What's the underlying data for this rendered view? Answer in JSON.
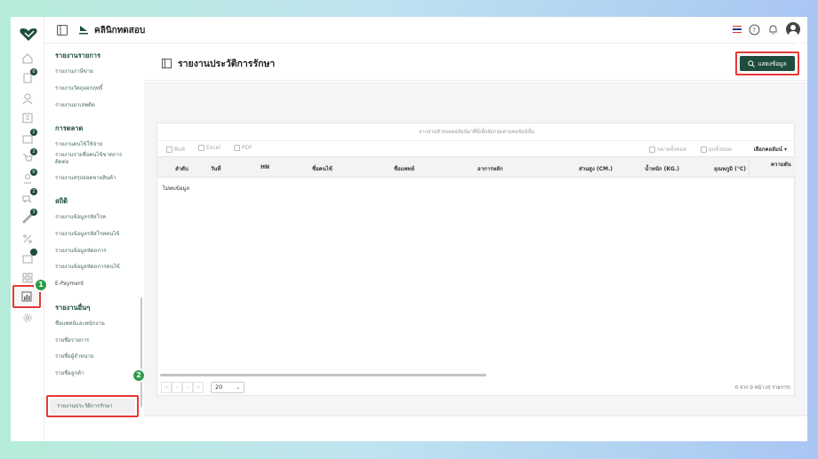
{
  "header": {
    "clinic_name": "คลินิกทดสอบ"
  },
  "rail": {
    "badges": [
      "0",
      "2",
      "2",
      "0",
      "2",
      "3"
    ]
  },
  "menu": {
    "groups": [
      {
        "title": "รายงานรายการ",
        "items": [
          "รายงานภาษีขาย",
          "รายงานวัตถุออกฤทธิ์",
          "รายงานยาเสพติด"
        ]
      },
      {
        "title": "การตลาด",
        "items": [
          "รายงานคนไข้ใช้จ่าย",
          "รายงานรายชื่อคนไข้ขาดการติดต่อ",
          "รายงานสรุปยอดขายสินค้า"
        ]
      },
      {
        "title": "สถิติ",
        "items": [
          "รายงานข้อมูลรหัสโรค",
          "รายงานข้อมูลรหัสโรคคนไข้",
          "รายงานข้อมูลหัตถการ",
          "รายงานข้อมูลหัตถการคนไข้",
          "E-Payment"
        ]
      },
      {
        "title": "รายงานอื่นๆ",
        "items": [
          "ชื่อแพทย์และพนักงาน",
          "รายชื่อรายการ",
          "รายชื่อผู้จำหน่าย",
          "รายชื่อลูกค้า",
          "รายงานประวัติการรักษา"
        ]
      }
    ]
  },
  "steps": [
    "1",
    "2",
    "3"
  ],
  "page": {
    "title": "รายงานประวัติการรักษา",
    "show_button": "แสดงข้อมูล"
  },
  "grid": {
    "group_hint": "ลากส่วนหัวของคอลัมน์มาที่นี่เพื่อจัดกลุ่มตามคอลัมน์นั้น",
    "toolbar": {
      "print": "พิมพ์",
      "excel": "Excel",
      "pdf": "PDF",
      "expand_all": "ขยายทั้งหมด",
      "collapse_all": "ยุบทั้งหมด",
      "choose_columns": "เลือกคอลัมน์"
    },
    "columns": [
      "ลำดับ",
      "วันที่",
      "HN",
      "ชื่อคนไข้",
      "ชื่อแพทย์",
      "อาการหลัก",
      "ส่วนสูง (CM.)",
      "น้ำหนัก (KG.)",
      "อุณหภูมิ (°C)",
      "ความดัน"
    ],
    "empty_text": "ไม่พบข้อมูล",
    "page_size": "20",
    "page_info": "0 จาก 0 หน้า (0 รายการ)"
  },
  "colors": {
    "brand": "#1e4d3b",
    "highlight": "#e53935",
    "step": "#2e9c4a"
  }
}
